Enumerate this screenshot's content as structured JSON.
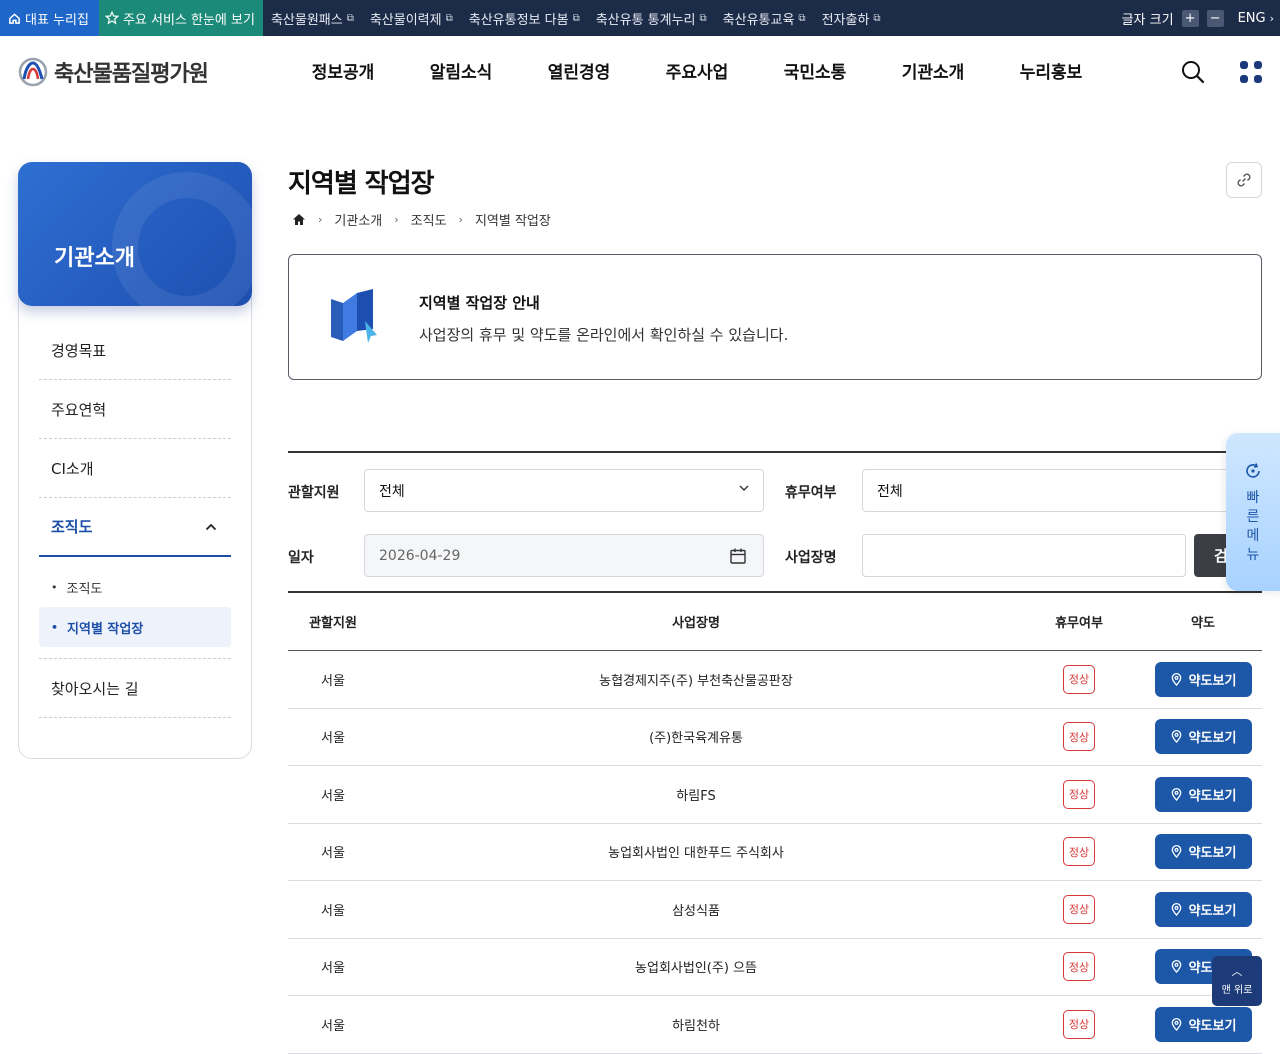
{
  "topbar": {
    "home_label": "대표 누리집",
    "main_service_label": "주요 서비스 한눈에 보기",
    "links": [
      "축산물원패스",
      "축산물이력제",
      "축산유통정보 다봄",
      "축산유통 통계누리",
      "축산유통교육",
      "전자출하"
    ],
    "font_size_label": "글자 크기",
    "font_plus": "+",
    "font_minus": "−",
    "lang_label": "ENG"
  },
  "header": {
    "logo_text": "축산물품질평가원",
    "nav": [
      "정보공개",
      "알림소식",
      "열린경영",
      "주요사업",
      "국민소통",
      "기관소개",
      "누리홍보"
    ]
  },
  "sidebar": {
    "title": "기관소개",
    "items": [
      "경영목표",
      "주요연혁",
      "CI소개",
      "조직도",
      "찾아오시는 길"
    ],
    "sub_items": [
      "조직도",
      "지역별 작업장"
    ]
  },
  "page": {
    "title": "지역별 작업장",
    "breadcrumb": [
      "기관소개",
      "조직도",
      "지역별 작업장"
    ],
    "info_title": "지역별 작업장 안내",
    "info_desc": "사업장의 휴무 및 약도를 온라인에서 확인하실 수 있습니다."
  },
  "form": {
    "branch_label": "관할지원",
    "branch_value": "전체",
    "holiday_label": "휴무여부",
    "holiday_value": "전체",
    "date_label": "일자",
    "date_value": "2026-04-29",
    "name_label": "사업장명",
    "name_value": "",
    "search_button": "검색"
  },
  "table": {
    "headers": [
      "관할지원",
      "사업장명",
      "휴무여부",
      "약도"
    ],
    "map_button_label": "약도보기",
    "rows": [
      {
        "branch": "서울",
        "name": "농협경제지주(주) 부천축산물공판장",
        "status": "정상"
      },
      {
        "branch": "서울",
        "name": "(주)한국육계유통",
        "status": "정상"
      },
      {
        "branch": "서울",
        "name": "하림FS",
        "status": "정상"
      },
      {
        "branch": "서울",
        "name": "농업회사법인 대한푸드 주식회사",
        "status": "정상"
      },
      {
        "branch": "서울",
        "name": "삼성식품",
        "status": "정상"
      },
      {
        "branch": "서울",
        "name": "농업회사법인(주) 으뜸",
        "status": "정상"
      },
      {
        "branch": "서울",
        "name": "하림천하",
        "status": "정상"
      }
    ]
  },
  "quick_menu": {
    "label": "빠른메뉴"
  },
  "totop": {
    "label": "맨 위로"
  },
  "colors": {
    "topbar": "#1c2b47",
    "home": "#1e66c8",
    "main_service": "#1b8a78",
    "primary": "#1c57a8",
    "status_red": "#d93a3a"
  }
}
